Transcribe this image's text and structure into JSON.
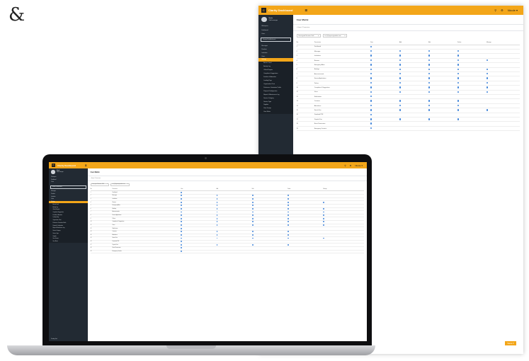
{
  "decoration": {
    "ampersand": "&"
  },
  "app": {
    "brand": "Clarity Dashboard",
    "menu_icon": "☰",
    "user_display": "Nicole ▾",
    "search_icon": "search-icon",
    "gear_icon": "gear-icon",
    "page_title": "User Matrix",
    "breadcrumb": "⌂ Home / Permission",
    "filter_role": "Unassigned Senators Staff",
    "filter_email": "its.@@agreengaurdian.com",
    "save_label": "Save ▾",
    "columns": [
      "No.",
      "Permission",
      "View",
      "Add",
      "Edit",
      "Delete",
      "Manage"
    ],
    "rows": [
      {
        "no": "1",
        "name": "Dashboard",
        "p": [
          1,
          0,
          0,
          0,
          0
        ]
      },
      {
        "no": "2",
        "name": "Messages",
        "p": [
          1,
          1,
          1,
          1,
          0
        ]
      },
      {
        "no": "3",
        "name": "Institutions",
        "p": [
          1,
          1,
          1,
          1,
          0
        ]
      },
      {
        "no": "4",
        "name": "Reviews",
        "p": [
          1,
          1,
          1,
          1,
          1
        ]
      },
      {
        "no": "5",
        "name": "Emergency Alerts",
        "p": [
          1,
          1,
          1,
          1,
          0
        ]
      },
      {
        "no": "6",
        "name": "Briefings",
        "p": [
          1,
          1,
          1,
          1,
          1
        ]
      },
      {
        "no": "7",
        "name": "Announcements",
        "p": [
          1,
          1,
          1,
          1,
          1
        ]
      },
      {
        "no": "8",
        "name": "Service Applications",
        "p": [
          1,
          1,
          1,
          1,
          1
        ]
      },
      {
        "no": "9",
        "name": "Polices",
        "p": [
          1,
          1,
          1,
          1,
          1
        ]
      },
      {
        "no": "10",
        "name": "Complaints & Suggestions",
        "p": [
          1,
          1,
          1,
          1,
          1
        ]
      },
      {
        "no": "11",
        "name": "Users",
        "p": [
          1,
          1,
          1,
          1,
          1
        ]
      },
      {
        "no": "12",
        "name": "Notifications",
        "p": [
          1,
          0,
          0,
          0,
          0
        ]
      },
      {
        "no": "13",
        "name": "Contracts",
        "p": [
          1,
          1,
          1,
          1,
          0
        ]
      },
      {
        "no": "14",
        "name": "Attendance",
        "p": [
          1,
          1,
          1,
          1,
          0
        ]
      },
      {
        "no": "15",
        "name": "Search Fee",
        "p": [
          1,
          1,
          1,
          1,
          1
        ]
      },
      {
        "no": "16",
        "name": "Download PDF",
        "p": [
          1,
          0,
          0,
          0,
          0
        ]
      },
      {
        "no": "17",
        "name": "Dispatch Fee",
        "p": [
          1,
          1,
          1,
          1,
          0
        ]
      },
      {
        "no": "18",
        "name": "Reset Permissions",
        "p": [
          1,
          0,
          0,
          0,
          0
        ]
      },
      {
        "no": "19",
        "name": "Emergency Contacts",
        "p": [
          1,
          0,
          0,
          0,
          0
        ]
      }
    ],
    "sidebar": {
      "user_name": "Nicole",
      "user_role": "Staff manager",
      "section": "Workspace",
      "select": "Senate Establishment",
      "top_items": [
        "Dashboard",
        "Users"
      ],
      "items": [
        "Messages",
        "Products",
        "Institution",
        "Users",
        "Settings"
      ],
      "sub_items": [
        "Access Level",
        "Activity Log",
        "Official Reports",
        "Complaints Suggestions",
        "Facilities & Amenities",
        "Landing Page",
        "Organization Chart",
        "Preference Orientation Profile",
        "Proposal Configuration",
        "Repair & Maintenance Log",
        "Service Category",
        "Service Type",
        "Supplier",
        "User Groups",
        "User Matrix"
      ],
      "footer": "Pending Task"
    }
  }
}
